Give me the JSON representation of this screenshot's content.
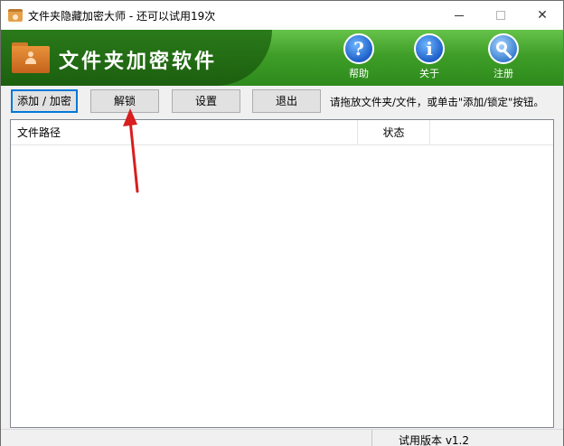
{
  "window": {
    "title": "文件夹隐藏加密大师 - 还可以试用19次",
    "minimize": "minimize",
    "maximize": "maximize",
    "close": "✕"
  },
  "banner": {
    "title": "文件夹加密软件",
    "help": {
      "label": "帮助",
      "icon_char": "?",
      "icon": "help-icon"
    },
    "about": {
      "label": "关于",
      "icon_char": "i",
      "icon": "info-icon"
    },
    "register": {
      "label": "注册",
      "icon": "key-icon"
    }
  },
  "toolbar": {
    "add_lock_label": "添加 / 加密",
    "unlock_label": "解锁",
    "settings_label": "设置",
    "exit_label": "退出",
    "hint": "请拖放文件夹/文件，或单击\"添加/锁定\"按钮。"
  },
  "list": {
    "columns": [
      "文件路径",
      "状态"
    ],
    "rows": []
  },
  "statusbar": {
    "version": "试用版本 v1.2"
  },
  "colors": {
    "banner_green": "#3f9e28",
    "annotation_red": "#d81e1e",
    "focus_blue": "#0078d7"
  }
}
